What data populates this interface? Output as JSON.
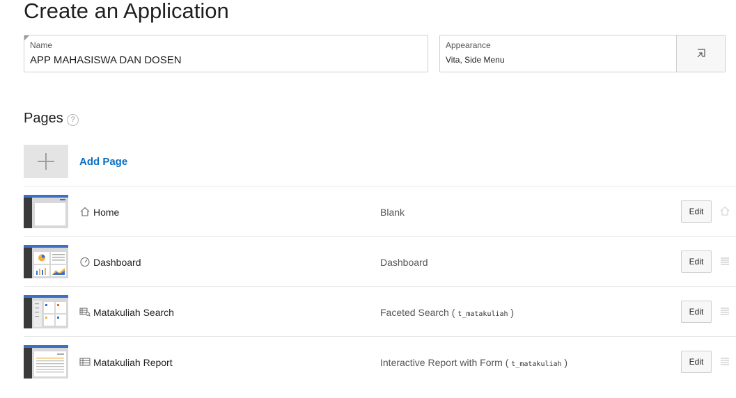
{
  "header": {
    "title": "Create an Application"
  },
  "form": {
    "name_label": "Name",
    "name_value": "APP MAHASISWA DAN DOSEN",
    "appearance_label": "Appearance",
    "appearance_value": "Vita, Side Menu",
    "appearance_button_icon": "set-appearance-icon"
  },
  "pages_section": {
    "title": "Pages",
    "help_glyph": "?",
    "add_label": "Add Page"
  },
  "pages": [
    {
      "name": "Home",
      "type": "Blank",
      "source": "",
      "icon": "home-icon",
      "edit_label": "Edit",
      "tail_icon": "home-icon"
    },
    {
      "name": "Dashboard",
      "type": "Dashboard",
      "source": "",
      "icon": "dashboard-icon",
      "edit_label": "Edit",
      "tail_icon": "drag-handle-icon"
    },
    {
      "name": "Matakuliah Search",
      "type": "Faceted Search",
      "source": "t_matakuliah",
      "icon": "faceted-search-icon",
      "edit_label": "Edit",
      "tail_icon": "drag-handle-icon"
    },
    {
      "name": "Matakuliah Report",
      "type": "Interactive Report with Form",
      "source": "t_matakuliah",
      "icon": "report-icon",
      "edit_label": "Edit",
      "tail_icon": "drag-handle-icon"
    }
  ],
  "colors": {
    "accent": "#0a6fc2",
    "thumb_header": "#3c70c7",
    "thumb_sidebar": "#3a3a3a"
  }
}
